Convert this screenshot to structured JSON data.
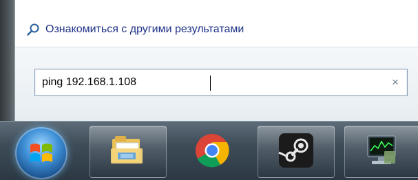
{
  "start_menu": {
    "see_more_label": "Ознакомиться с другими результатами",
    "search": {
      "value": "ping 192.168.1.108",
      "clear_label": "×"
    }
  },
  "taskbar": {
    "items": [
      {
        "name": "start-button",
        "icon": "windows-logo-icon"
      },
      {
        "name": "explorer",
        "icon": "folder-icon"
      },
      {
        "name": "chrome",
        "icon": "chrome-icon"
      },
      {
        "name": "steam",
        "icon": "steam-icon"
      },
      {
        "name": "resource-monitor",
        "icon": "monitor-icon"
      }
    ]
  },
  "colors": {
    "link": "#1e3287",
    "taskbar": "#3e4c58",
    "search_border": "#8a9fb5"
  }
}
